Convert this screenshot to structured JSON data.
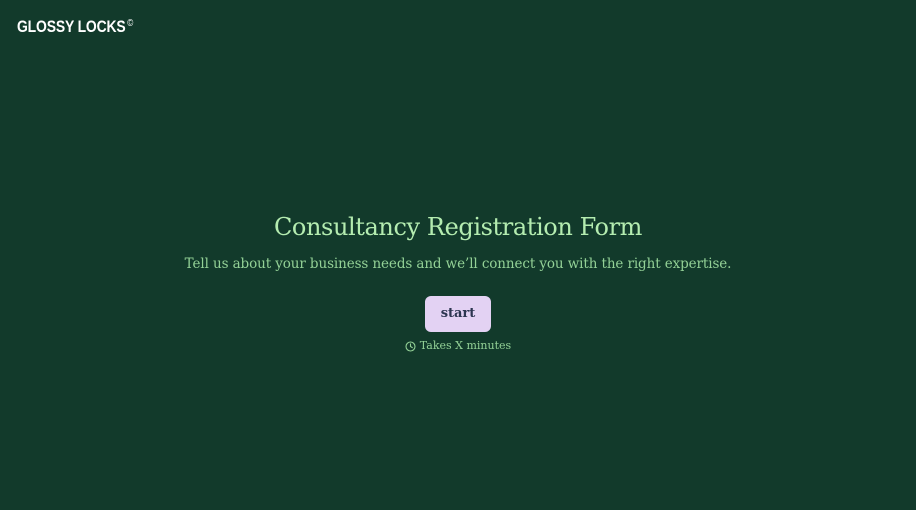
{
  "brand": {
    "name": "GLOSSY LOCKS",
    "mark": "©"
  },
  "hero": {
    "title": "Consultancy Registration Form",
    "subtitle": "Tell us about your business needs and we’ll connect you with the right expertise.",
    "start_label": "start",
    "duration_text": "Takes X minutes",
    "duration_icon": "clock-icon"
  },
  "colors": {
    "background": "#123a2b",
    "title": "#b4ecb0",
    "text": "#93d196",
    "button_bg": "#e3d2f3",
    "button_text": "#2c3550",
    "logo": "#ffffff"
  }
}
